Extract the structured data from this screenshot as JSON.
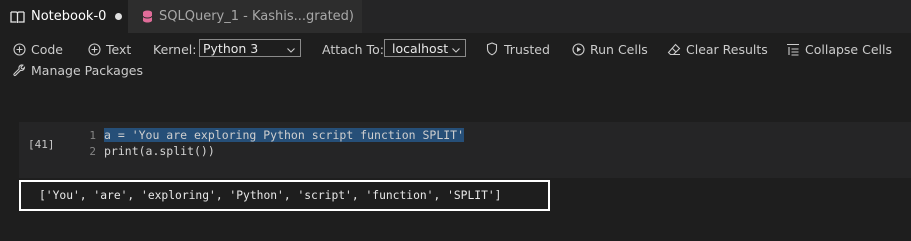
{
  "tabs": [
    {
      "label": "Notebook-0",
      "icon": "book-icon",
      "dirty": true
    },
    {
      "label": "SQLQuery_1 - Kashis...grated)",
      "icon": "database-icon",
      "dirty": true
    }
  ],
  "toolbar": {
    "code": "Code",
    "text": "Text",
    "kernel_label": "Kernel:",
    "kernel_value": "Python 3",
    "attach_label": "Attach To:",
    "attach_value": "localhost",
    "trusted": "Trusted",
    "run_cells": "Run Cells",
    "clear_results": "Clear Results",
    "collapse_cells": "Collapse Cells",
    "manage_packages": "Manage Packages"
  },
  "cell": {
    "exec_count": "[41]",
    "line_numbers": [
      "1",
      "2"
    ],
    "code_lines": [
      "a = 'You are exploring Python script function SPLIT'",
      "print(a.split())"
    ],
    "output": "['You', 'are', 'exploring', 'Python', 'script', 'function', 'SPLIT']"
  },
  "colors": {
    "background": "#1e1e1e",
    "tabbar": "#252526",
    "cell_background": "#252526",
    "selection": "#264f78",
    "sql_icon": "#e06c99",
    "output_border": "#ffffff"
  }
}
